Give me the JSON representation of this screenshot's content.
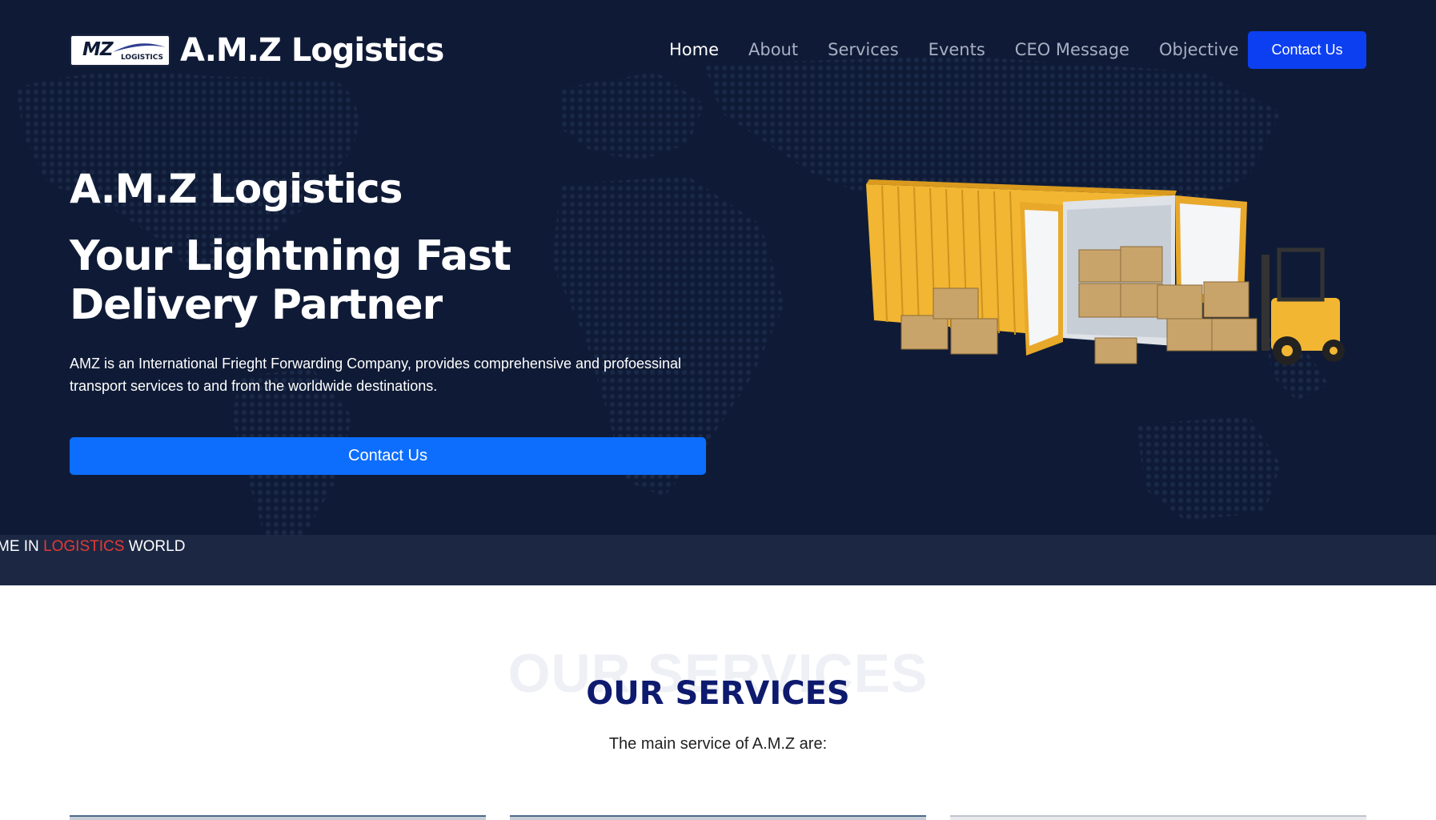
{
  "brand": {
    "logo_text": "MZ",
    "logo_subtext": "LOGISTICS",
    "name": "A.M.Z Logistics"
  },
  "nav": {
    "items": [
      {
        "label": "Home",
        "active": true
      },
      {
        "label": "About"
      },
      {
        "label": "Services"
      },
      {
        "label": "Events"
      },
      {
        "label": "CEO Message"
      },
      {
        "label": "Objective"
      }
    ],
    "cta_label": "Contact Us"
  },
  "hero": {
    "brand": "A.M.Z Logistics",
    "title": "Your Lightning Fast Delivery Partner",
    "description": "AMZ is an International Frieght Forwarding Company, provides comprehensive and profoessinal transport services to and from the worldwide destinations.",
    "cta_label": "Contact Us"
  },
  "ticker": {
    "prefix": "ME IN ",
    "highlight": "LOGISTICS",
    "suffix": " WORLD"
  },
  "services": {
    "ghost_title": "OUR SERVICES",
    "title": "OUR SERVICES",
    "subtitle": "The main service of A.M.Z are:"
  },
  "colors": {
    "hero_bg": "#0f1b36",
    "ticker_bg": "#1c2843",
    "primary_button": "#0d6efd",
    "nav_button": "#0c3ff0",
    "services_title": "#0d1a6e",
    "ticker_highlight": "#e53935"
  },
  "icons": [
    "world-map-dots",
    "shipping-container",
    "forklift"
  ]
}
